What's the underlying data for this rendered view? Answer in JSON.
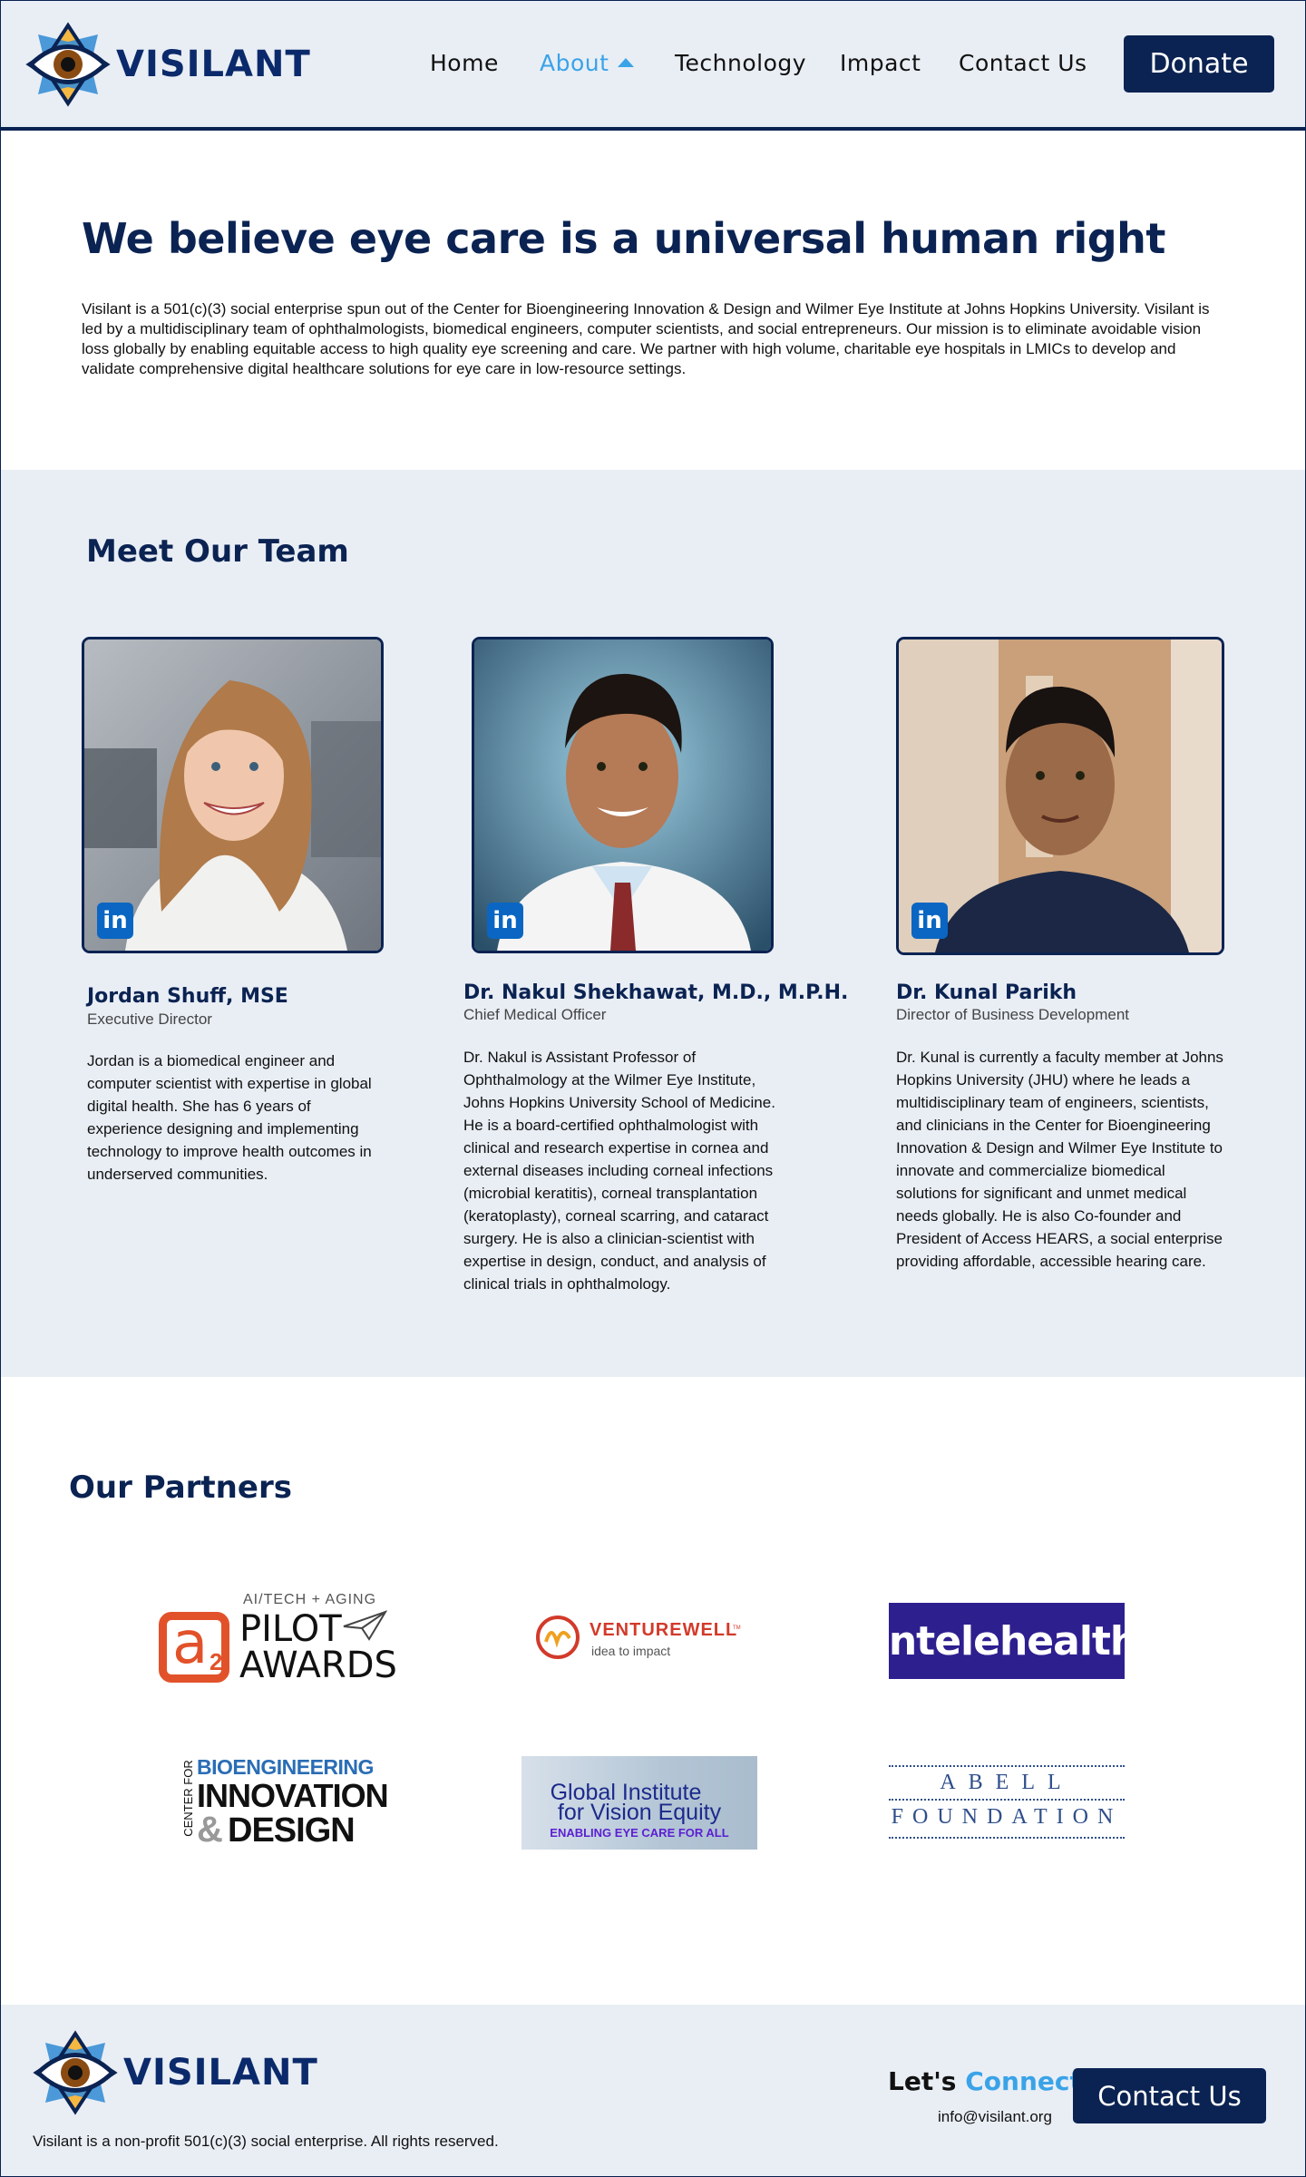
{
  "brand": {
    "name": "VISILANT",
    "primary": "#0b2352",
    "accent": "#3aa3e8",
    "panel": "#e9eef5"
  },
  "nav": {
    "items": [
      {
        "label": "Home"
      },
      {
        "label": "About"
      },
      {
        "label": "Technology"
      },
      {
        "label": "Impact"
      },
      {
        "label": "Contact Us"
      }
    ],
    "active": "About",
    "donate_label": "Donate"
  },
  "intro": {
    "headline": "We believe eye care is a universal human right",
    "body": "Visilant is a 501(c)(3) social enterprise spun out of the Center for Bioengineering Innovation & Design and Wilmer Eye Institute at Johns Hopkins University. Visilant is led by a multidisciplinary team of ophthalmologists, biomedical engineers, computer scientists, and social entrepreneurs. Our mission is to eliminate avoidable vision loss globally by enabling equitable access to high quality eye screening and care. We partner with high volume, charitable eye hospitals in LMICs to develop and validate comprehensive digital healthcare solutions for eye care in low-resource settings."
  },
  "team": {
    "title": "Meet Our Team",
    "members": [
      {
        "name": "Jordan Shuff, MSE",
        "role": "Executive Director",
        "bio": "Jordan is a biomedical engineer and computer scientist with expertise in global digital health. She has 6 years of experience designing and implementing technology to improve health outcomes in underserved communities.",
        "linkedin_icon": "in"
      },
      {
        "name": "Dr. Nakul Shekhawat, M.D., M.P.H.",
        "role": "Chief Medical Officer",
        "bio": "Dr. Nakul is Assistant Professor of Ophthalmology at the Wilmer Eye Institute, Johns Hopkins University School of Medicine. He is a board-certified ophthalmologist with clinical and research expertise in cornea and external diseases including corneal infections (microbial keratitis), corneal transplantation (keratoplasty), corneal scarring, and cataract surgery. He is also a clinician-scientist with expertise in design, conduct, and analysis of clinical trials in ophthalmology.",
        "linkedin_icon": "in"
      },
      {
        "name": "Dr. Kunal Parikh",
        "role": "Director of Business Development",
        "bio": "Dr. Kunal is currently a faculty member at Johns Hopkins University (JHU) where he leads a multidisciplinary team of engineers, scientists, and clinicians in the Center for Bioengineering Innovation & Design and Wilmer Eye Institute to innovate and commercialize biomedical solutions for significant and unmet medical needs globally. He is also Co-founder and President of Access HEARS, a social enterprise providing affordable, accessible hearing care.",
        "linkedin_icon": "in"
      }
    ]
  },
  "partners": {
    "title": "Our Partners",
    "logos": {
      "a2": {
        "top": "AI/TECH + AGING",
        "a": "a",
        "two": "2",
        "line1": "PILOT",
        "line2": "AWARDS"
      },
      "venturewell": {
        "name": "VENTUREWELL",
        "tm": "TM",
        "tagline": "idea to impact"
      },
      "intelehealth": {
        "name": "intelehealth"
      },
      "cbid": {
        "side": "CENTER FOR",
        "line1": "BIOENGINEERING",
        "line2": "INNOVATION",
        "amp": "&",
        "line3": "DESIGN"
      },
      "give": {
        "line1": "Global Institute",
        "line2": "for Vision Equity",
        "tagline": "ENABLING EYE CARE FOR ALL"
      },
      "abell": {
        "line1": "ABELL",
        "line2": "FOUNDATION"
      }
    }
  },
  "footer": {
    "lets": "Let's",
    "connect": "Connect!",
    "email": "info@visilant.org",
    "contact_label": "Contact Us",
    "copyright": "Visilant is a non-profit 501(c)(3) social enterprise. All rights reserved."
  }
}
